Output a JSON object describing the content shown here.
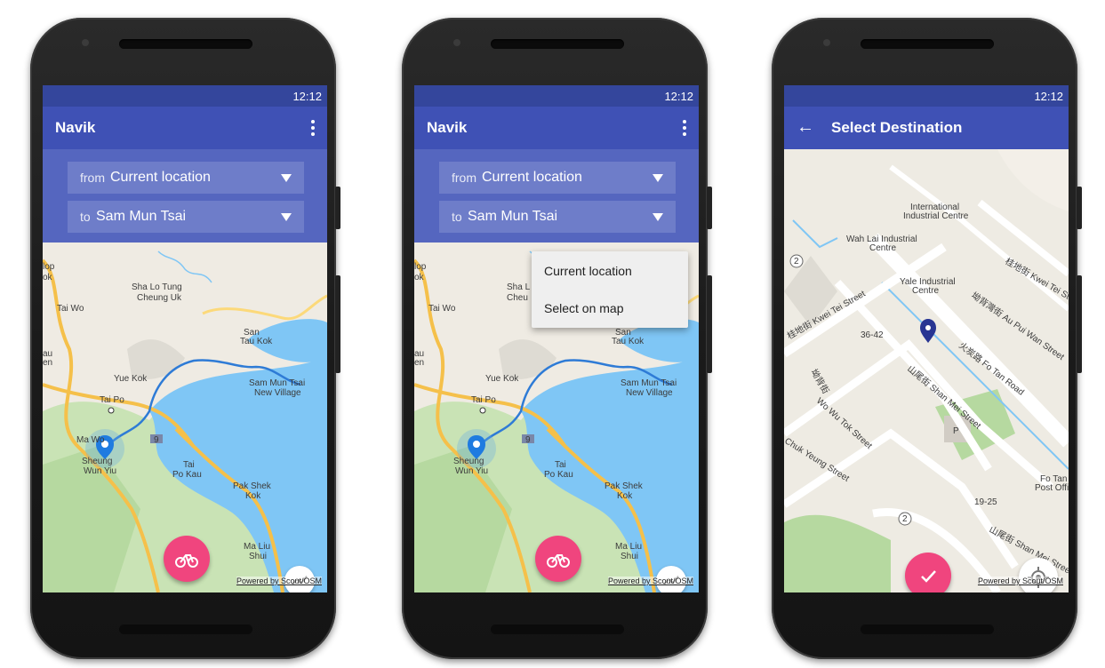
{
  "colors": {
    "primary": "#3f51b5",
    "primary_dark": "#34469c",
    "accent": "#f0457e",
    "water": "#7fc6f5",
    "route": "#2e7bd6"
  },
  "phones": [
    {
      "status_time": "12:12",
      "app_title": "Navik",
      "from_prefix": "from",
      "from_value": "Current location",
      "to_prefix": "to",
      "to_value": "Sam Mun Tsai",
      "map_labels": [
        "Sha Lo Tung",
        "Cheung Uk",
        "Tai Wo",
        "San",
        "Tau Kok",
        "Yue Kok",
        "Sam Mun Tsai",
        "New Village",
        "Tai Po",
        "Ma Wo",
        "Sheung",
        "Wun Yiu",
        "Tai",
        "Po Kau",
        "Pak Shek",
        "Kok",
        "Ma Liu",
        "Shui",
        "9",
        "lop",
        "ok",
        "au",
        "en"
      ],
      "fab_icon": "bike-icon",
      "small_fab_icon": "route-icon",
      "powered_by": "Powered by Scout/OSM"
    },
    {
      "status_time": "12:12",
      "app_title": "Navik",
      "from_prefix": "from",
      "from_value": "Current location",
      "to_prefix": "to",
      "to_value": "Sam Mun Tsai",
      "dropdown": [
        "Current location",
        "Select on map"
      ],
      "map_labels": [
        "Sha L",
        "Cheu",
        "Tai Wo",
        "San",
        "Tau Kok",
        "Yue Kok",
        "Sam Mun Tsai",
        "New Village",
        "Tai Po",
        "Sheung",
        "Wun Yiu",
        "Tai",
        "Po Kau",
        "Pak Shek",
        "Kok",
        "Ma Liu",
        "Shui",
        "9",
        "lop",
        "ok",
        "au",
        "en"
      ],
      "fab_icon": "bike-icon",
      "small_fab_icon": "route-icon",
      "powered_by": "Powered by Scout/OSM"
    },
    {
      "status_time": "12:12",
      "app_title": "Select Destination",
      "map_labels": [
        "International",
        "Industrial Centre",
        "Wah Lai Industrial",
        "Centre",
        "Yale Industrial",
        "Centre",
        "桂地街 Kwei Tei St",
        "桂地街 Kwei Tei Street",
        "坳背灣街 Au Pui Wan Street",
        "火炭路 Fo Tan Road",
        "36-42",
        "坳背街",
        "Wo Wu Tok Street",
        "山尾街 Shan Mei Street",
        "Chuk Yeung Street",
        "P",
        "Fo Tan",
        "Post Office",
        "19-25",
        "山尾街 Shan Mei Street",
        "2",
        "2"
      ],
      "fab_icon": "check-icon",
      "small_fab_icon": "my-location-icon",
      "powered_by": "Powered by Scout/OSM"
    }
  ]
}
